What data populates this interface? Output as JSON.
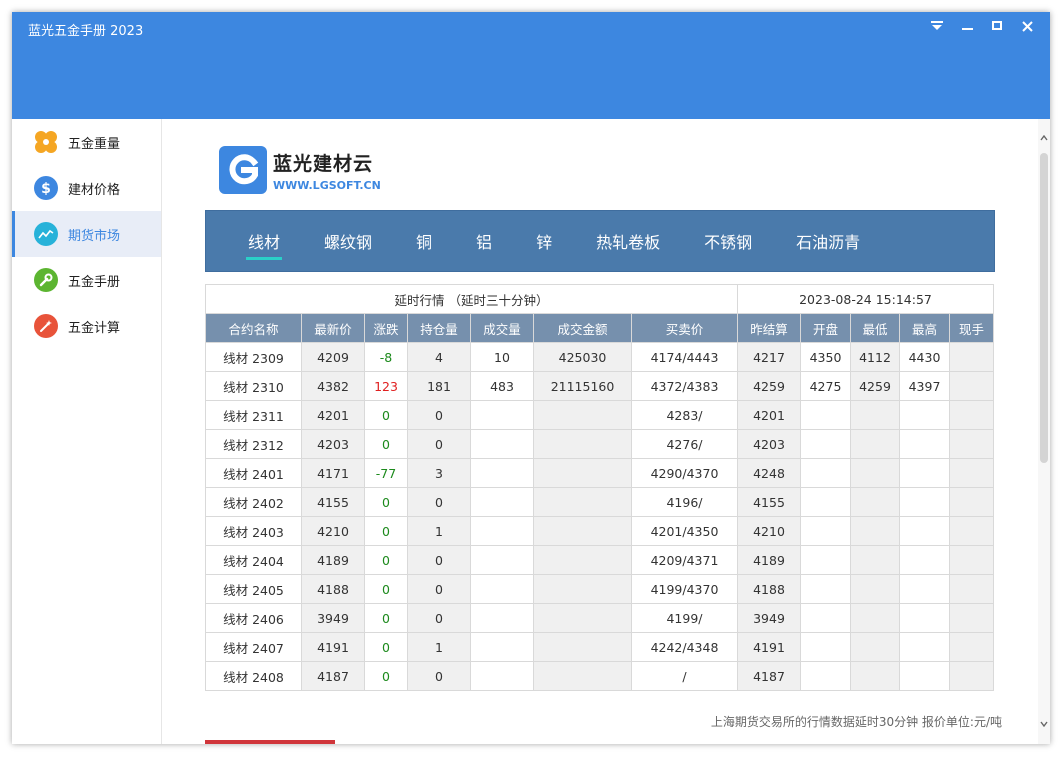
{
  "app": {
    "title": "蓝光五金手册 2023"
  },
  "sidebar": {
    "items": [
      {
        "label": "五金重量",
        "icon": "clover-icon",
        "color": "#f5a623"
      },
      {
        "label": "建材价格",
        "icon": "dollar-icon",
        "color": "#3d87e0"
      },
      {
        "label": "期货市场",
        "icon": "trend-line-icon",
        "color": "#27b2d9"
      },
      {
        "label": "五金手册",
        "icon": "wrench-icon",
        "color": "#5cb531"
      },
      {
        "label": "五金计算",
        "icon": "magic-wand-icon",
        "color": "#e8533a"
      }
    ],
    "active_index": 2
  },
  "logo": {
    "name": "蓝光建材云",
    "url": "WWW.LGSOFT.CN"
  },
  "tabs": [
    {
      "label": "线材"
    },
    {
      "label": "螺纹钢"
    },
    {
      "label": "铜"
    },
    {
      "label": "铝"
    },
    {
      "label": "锌"
    },
    {
      "label": "热轧卷板"
    },
    {
      "label": "不锈钢"
    },
    {
      "label": "石油沥青"
    }
  ],
  "table": {
    "caption_left": "延时行情 （延时三十分钟）",
    "caption_right": "2023-08-24 15:14:57",
    "headers": [
      "合约名称",
      "最新价",
      "涨跌",
      "持仓量",
      "成交量",
      "成交金额",
      "买卖价",
      "昨结算",
      "开盘",
      "最低",
      "最高",
      "现手"
    ],
    "rows": [
      [
        "线材 2309",
        "4209",
        "-8",
        "4",
        "10",
        "425030",
        "4174/4443",
        "4217",
        "4350",
        "4112",
        "4430",
        ""
      ],
      [
        "线材 2310",
        "4382",
        "123",
        "181",
        "483",
        "21115160",
        "4372/4383",
        "4259",
        "4275",
        "4259",
        "4397",
        ""
      ],
      [
        "线材 2311",
        "4201",
        "0",
        "0",
        "",
        "",
        "4283/",
        "4201",
        "",
        "",
        "",
        ""
      ],
      [
        "线材 2312",
        "4203",
        "0",
        "0",
        "",
        "",
        "4276/",
        "4203",
        "",
        "",
        "",
        ""
      ],
      [
        "线材 2401",
        "4171",
        "-77",
        "3",
        "",
        "",
        "4290/4370",
        "4248",
        "",
        "",
        "",
        ""
      ],
      [
        "线材 2402",
        "4155",
        "0",
        "0",
        "",
        "",
        "4196/",
        "4155",
        "",
        "",
        "",
        ""
      ],
      [
        "线材 2403",
        "4210",
        "0",
        "1",
        "",
        "",
        "4201/4350",
        "4210",
        "",
        "",
        "",
        ""
      ],
      [
        "线材 2404",
        "4189",
        "0",
        "0",
        "",
        "",
        "4209/4371",
        "4189",
        "",
        "",
        "",
        ""
      ],
      [
        "线材 2405",
        "4188",
        "0",
        "0",
        "",
        "",
        "4199/4370",
        "4188",
        "",
        "",
        "",
        ""
      ],
      [
        "线材 2406",
        "3949",
        "0",
        "0",
        "",
        "",
        "4199/",
        "3949",
        "",
        "",
        "",
        ""
      ],
      [
        "线材 2407",
        "4191",
        "0",
        "1",
        "",
        "",
        "4242/4348",
        "4191",
        "",
        "",
        "",
        ""
      ],
      [
        "线材 2408",
        "4187",
        "0",
        "0",
        "",
        "",
        "/",
        "4187",
        "",
        "",
        "",
        ""
      ]
    ]
  },
  "footer_note": "上海期货交易所的行情数据延时30分钟 报价单位:元/吨",
  "colors": {
    "titlebar": "#3d87e0",
    "tabbar": "#4a7aab",
    "header": "#7690ad",
    "up": "#e02020",
    "down": "#1c8a1c",
    "tab_underline": "#2ad0c8"
  }
}
